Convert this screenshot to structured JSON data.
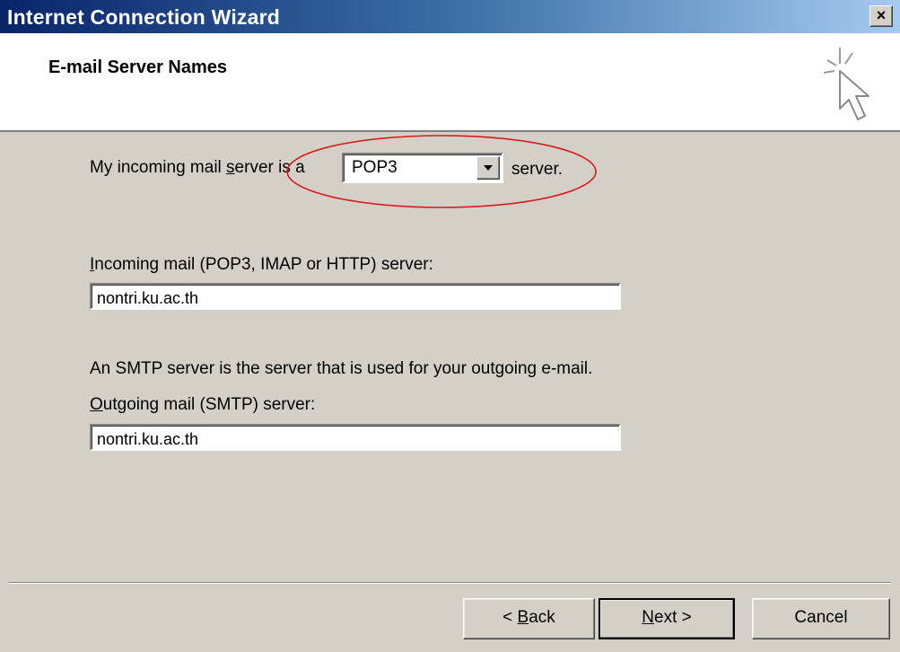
{
  "window": {
    "title": "Internet Connection Wizard",
    "close_label": "×"
  },
  "header": {
    "heading": "E-mail Server Names"
  },
  "incoming_type": {
    "prefix_before": "My incoming mail ",
    "prefix_underlined": "s",
    "prefix_after": "erver is a",
    "selected": "POP3",
    "suffix": "server."
  },
  "incoming_server": {
    "label_underlined": "I",
    "label_rest": "ncoming mail (POP3, IMAP or HTTP) server:",
    "value": "nontri.ku.ac.th"
  },
  "smtp_note": "An SMTP server is the server that is used for your outgoing e-mail.",
  "outgoing_server": {
    "label_underlined": "O",
    "label_rest": "utgoing mail (SMTP) server:",
    "value": "nontri.ku.ac.th"
  },
  "buttons": {
    "back_prefix": "< ",
    "back_underlined": "B",
    "back_rest": "ack",
    "next_underlined": "N",
    "next_rest": "ext >",
    "cancel": "Cancel"
  },
  "annotation": {
    "ellipse_color": "#d81c1c"
  },
  "colors": {
    "titlebar": "#0a246a",
    "dialog_face": "#d4d0c8"
  }
}
